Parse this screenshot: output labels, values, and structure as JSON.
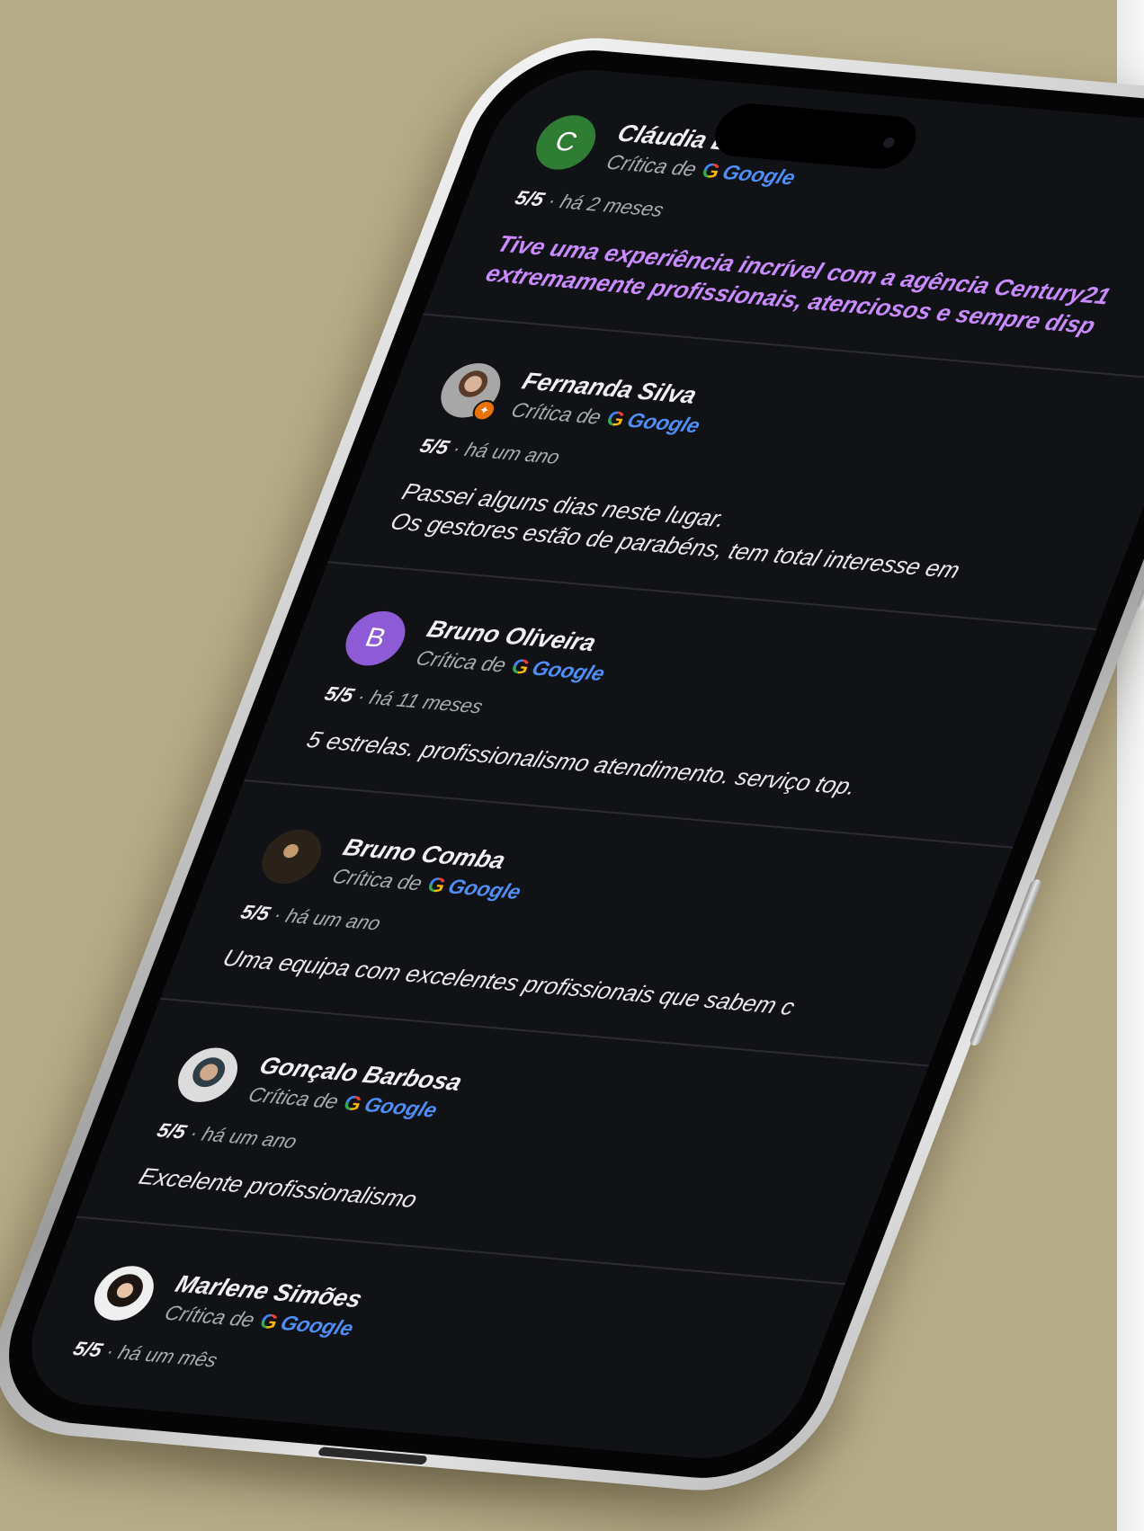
{
  "reviews": [
    {
      "initial": "C",
      "avatar_color": "#2e7d32",
      "name": "Cláudia L",
      "source_prefix": "Crítica de",
      "source": "Google",
      "score": "5/5",
      "age": "há 2 meses",
      "lines": [
        "Tive uma experiência incrível com a agência Century21",
        "extremamente profissionais, atenciosos e sempre disp"
      ],
      "text_color": "#c98bff"
    },
    {
      "initial": "",
      "avatar_style": "photo",
      "name": "Fernanda Silva",
      "source_prefix": "Crítica de",
      "source": "Google",
      "score": "5/5",
      "age": "há um ano",
      "lines": [
        "Passei alguns dias neste lugar.",
        "Os gestores estão de parabéns, tem total interesse em"
      ]
    },
    {
      "initial": "B",
      "avatar_color": "#8e5bd6",
      "name": "Bruno Oliveira",
      "source_prefix": "Crítica de",
      "source": "Google",
      "score": "5/5",
      "age": "há 11 meses",
      "lines": [
        "5 estrelas. profissionalismo atendimento. serviço top."
      ]
    },
    {
      "initial": "",
      "avatar_style": "dark",
      "name": "Bruno Comba",
      "source_prefix": "Crítica de",
      "source": "Google",
      "score": "5/5",
      "age": "há um ano",
      "lines": [
        "Uma equipa com excelentes profissionais que sabem c"
      ]
    },
    {
      "initial": "",
      "avatar_style": "cap",
      "name": "Gonçalo Barbosa",
      "source_prefix": "Crítica de",
      "source": "Google",
      "score": "5/5",
      "age": "há um ano",
      "lines": [
        "Excelente profissionalismo"
      ]
    },
    {
      "initial": "",
      "avatar_style": "hair",
      "name": "Marlene Simões",
      "source_prefix": "Crítica de",
      "source": "Google",
      "score": "5/5",
      "age": "há um mês",
      "lines": []
    }
  ],
  "separator": "·",
  "google_letter": "G"
}
